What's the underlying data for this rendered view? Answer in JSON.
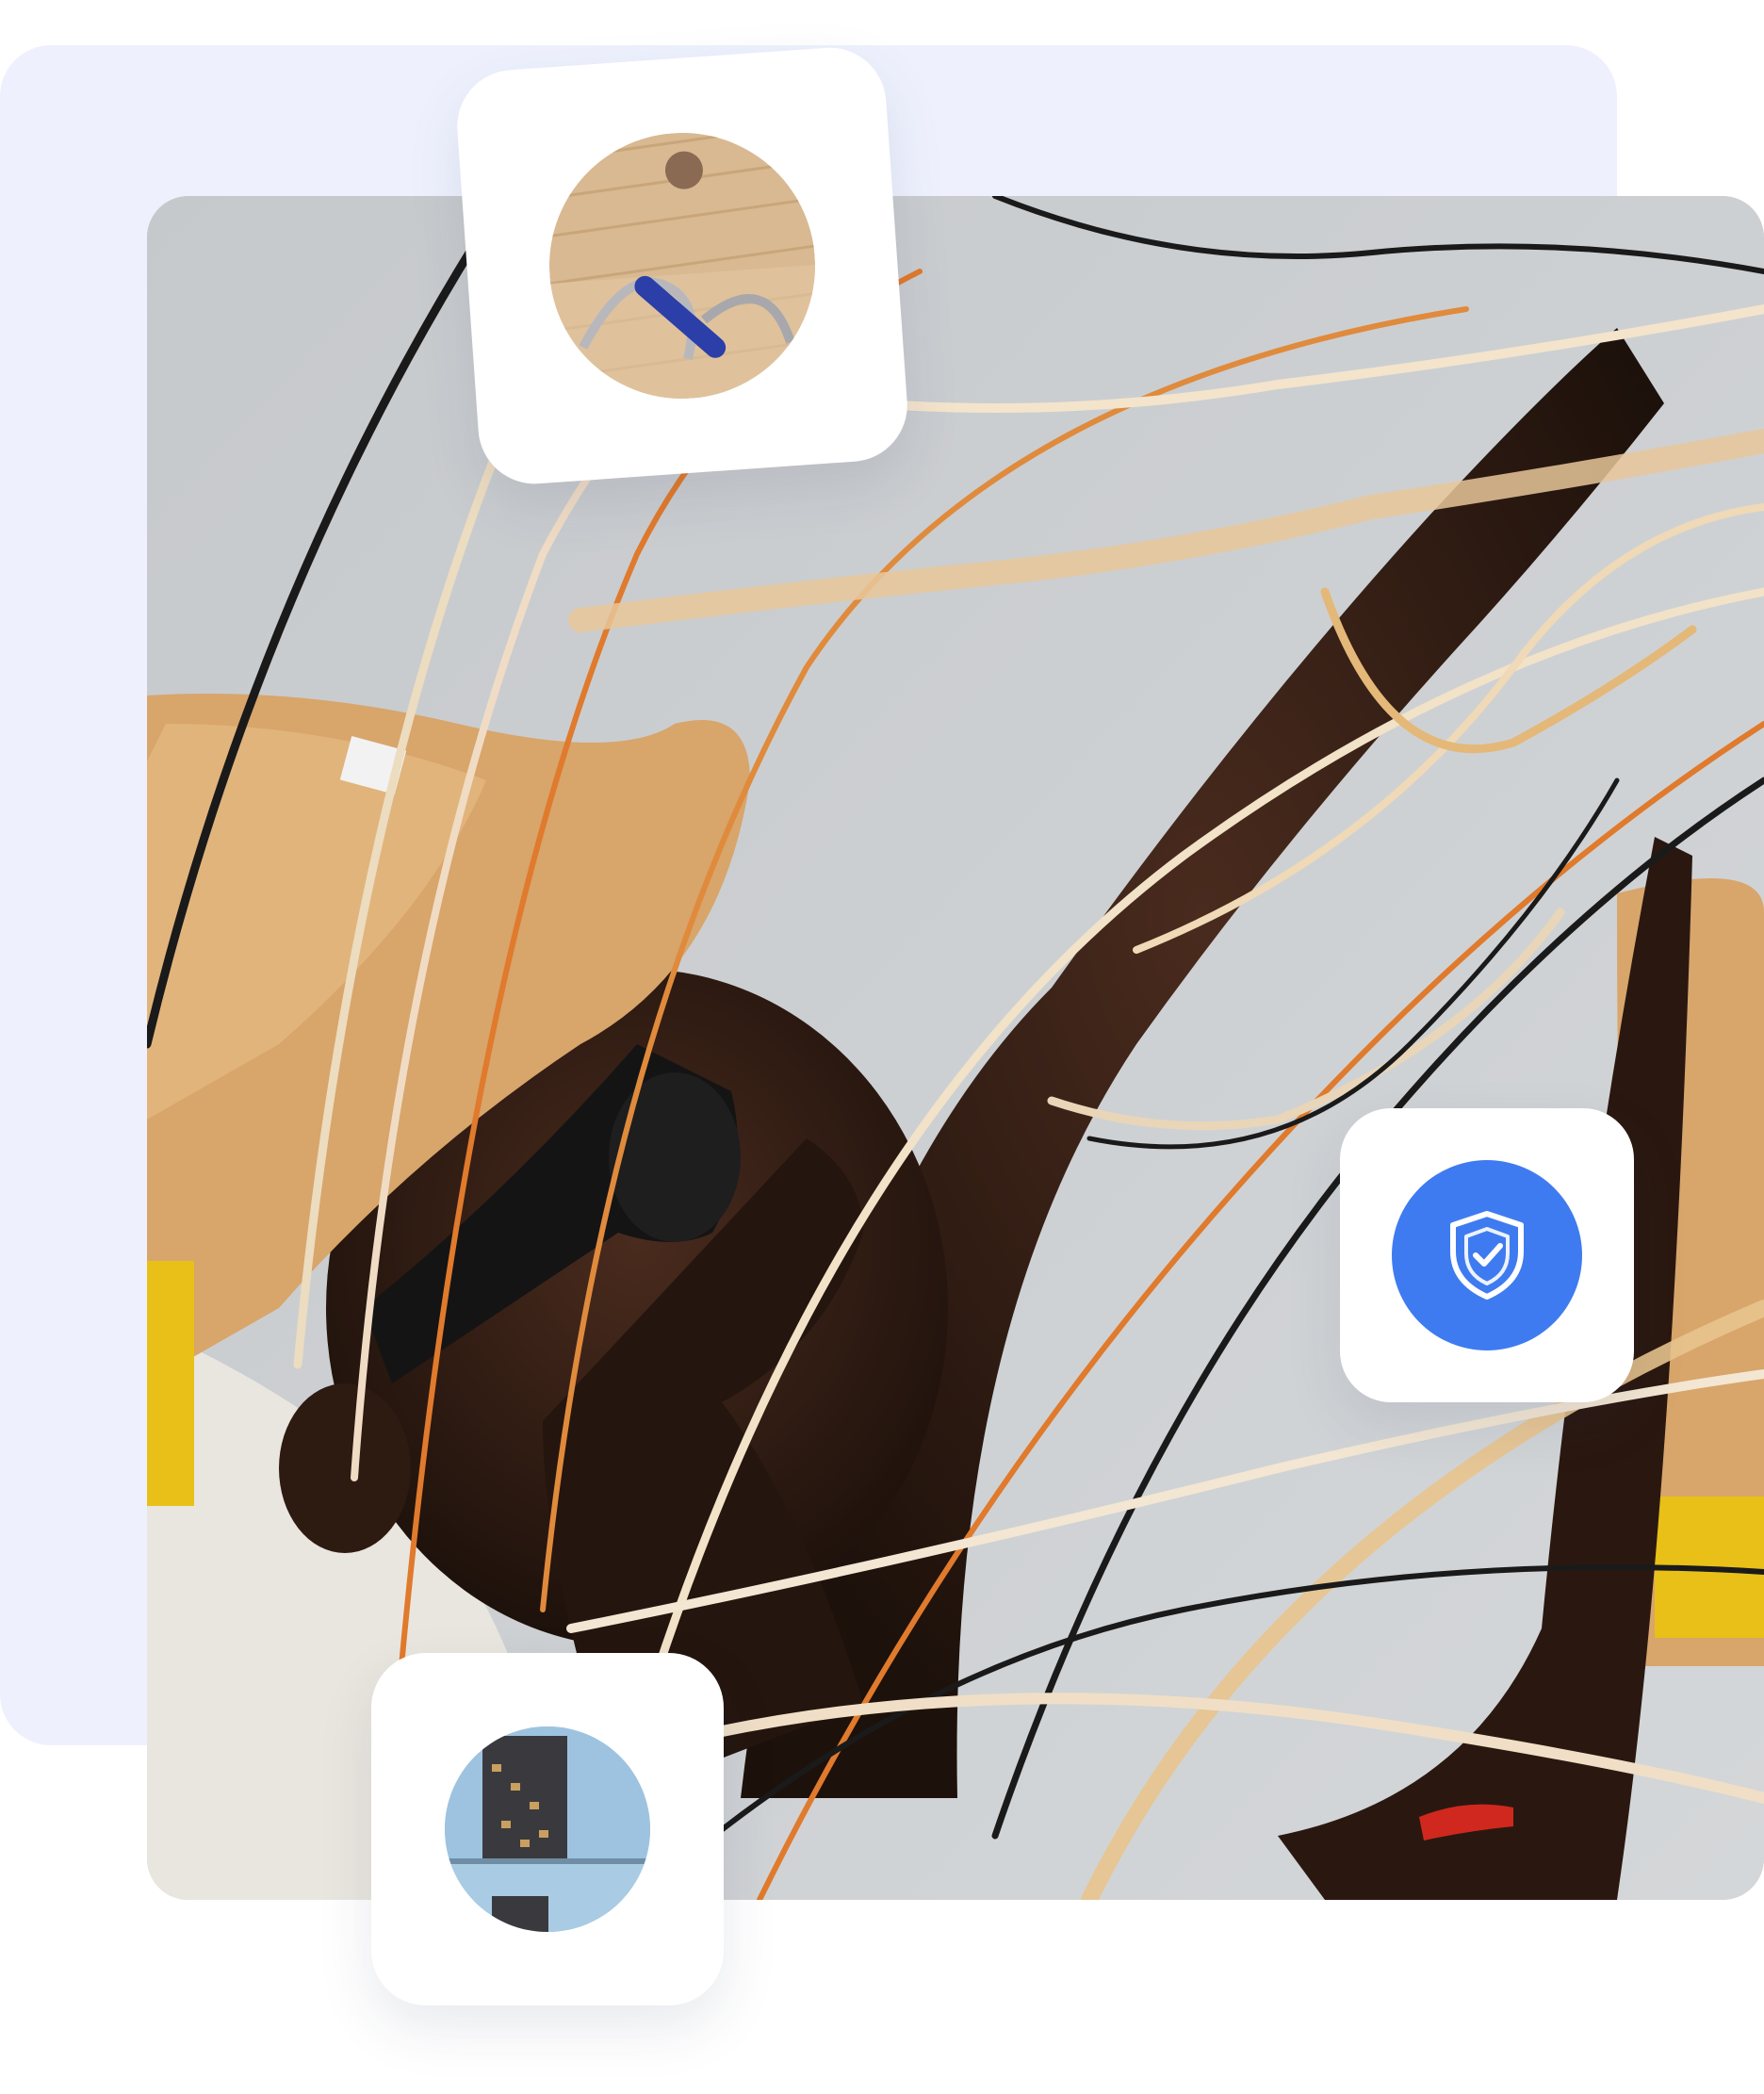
{
  "colors": {
    "panel_background": "#eef1fd",
    "accent_blue": "#3f7bf0",
    "card_background": "#ffffff"
  },
  "main_photo": {
    "icon": "electrician-with-wires-photo"
  },
  "floating_cards": [
    {
      "icon": "electrician-tools-thumbnail"
    },
    {
      "icon": "shield-check-icon"
    },
    {
      "icon": "building-thumbnail"
    }
  ]
}
